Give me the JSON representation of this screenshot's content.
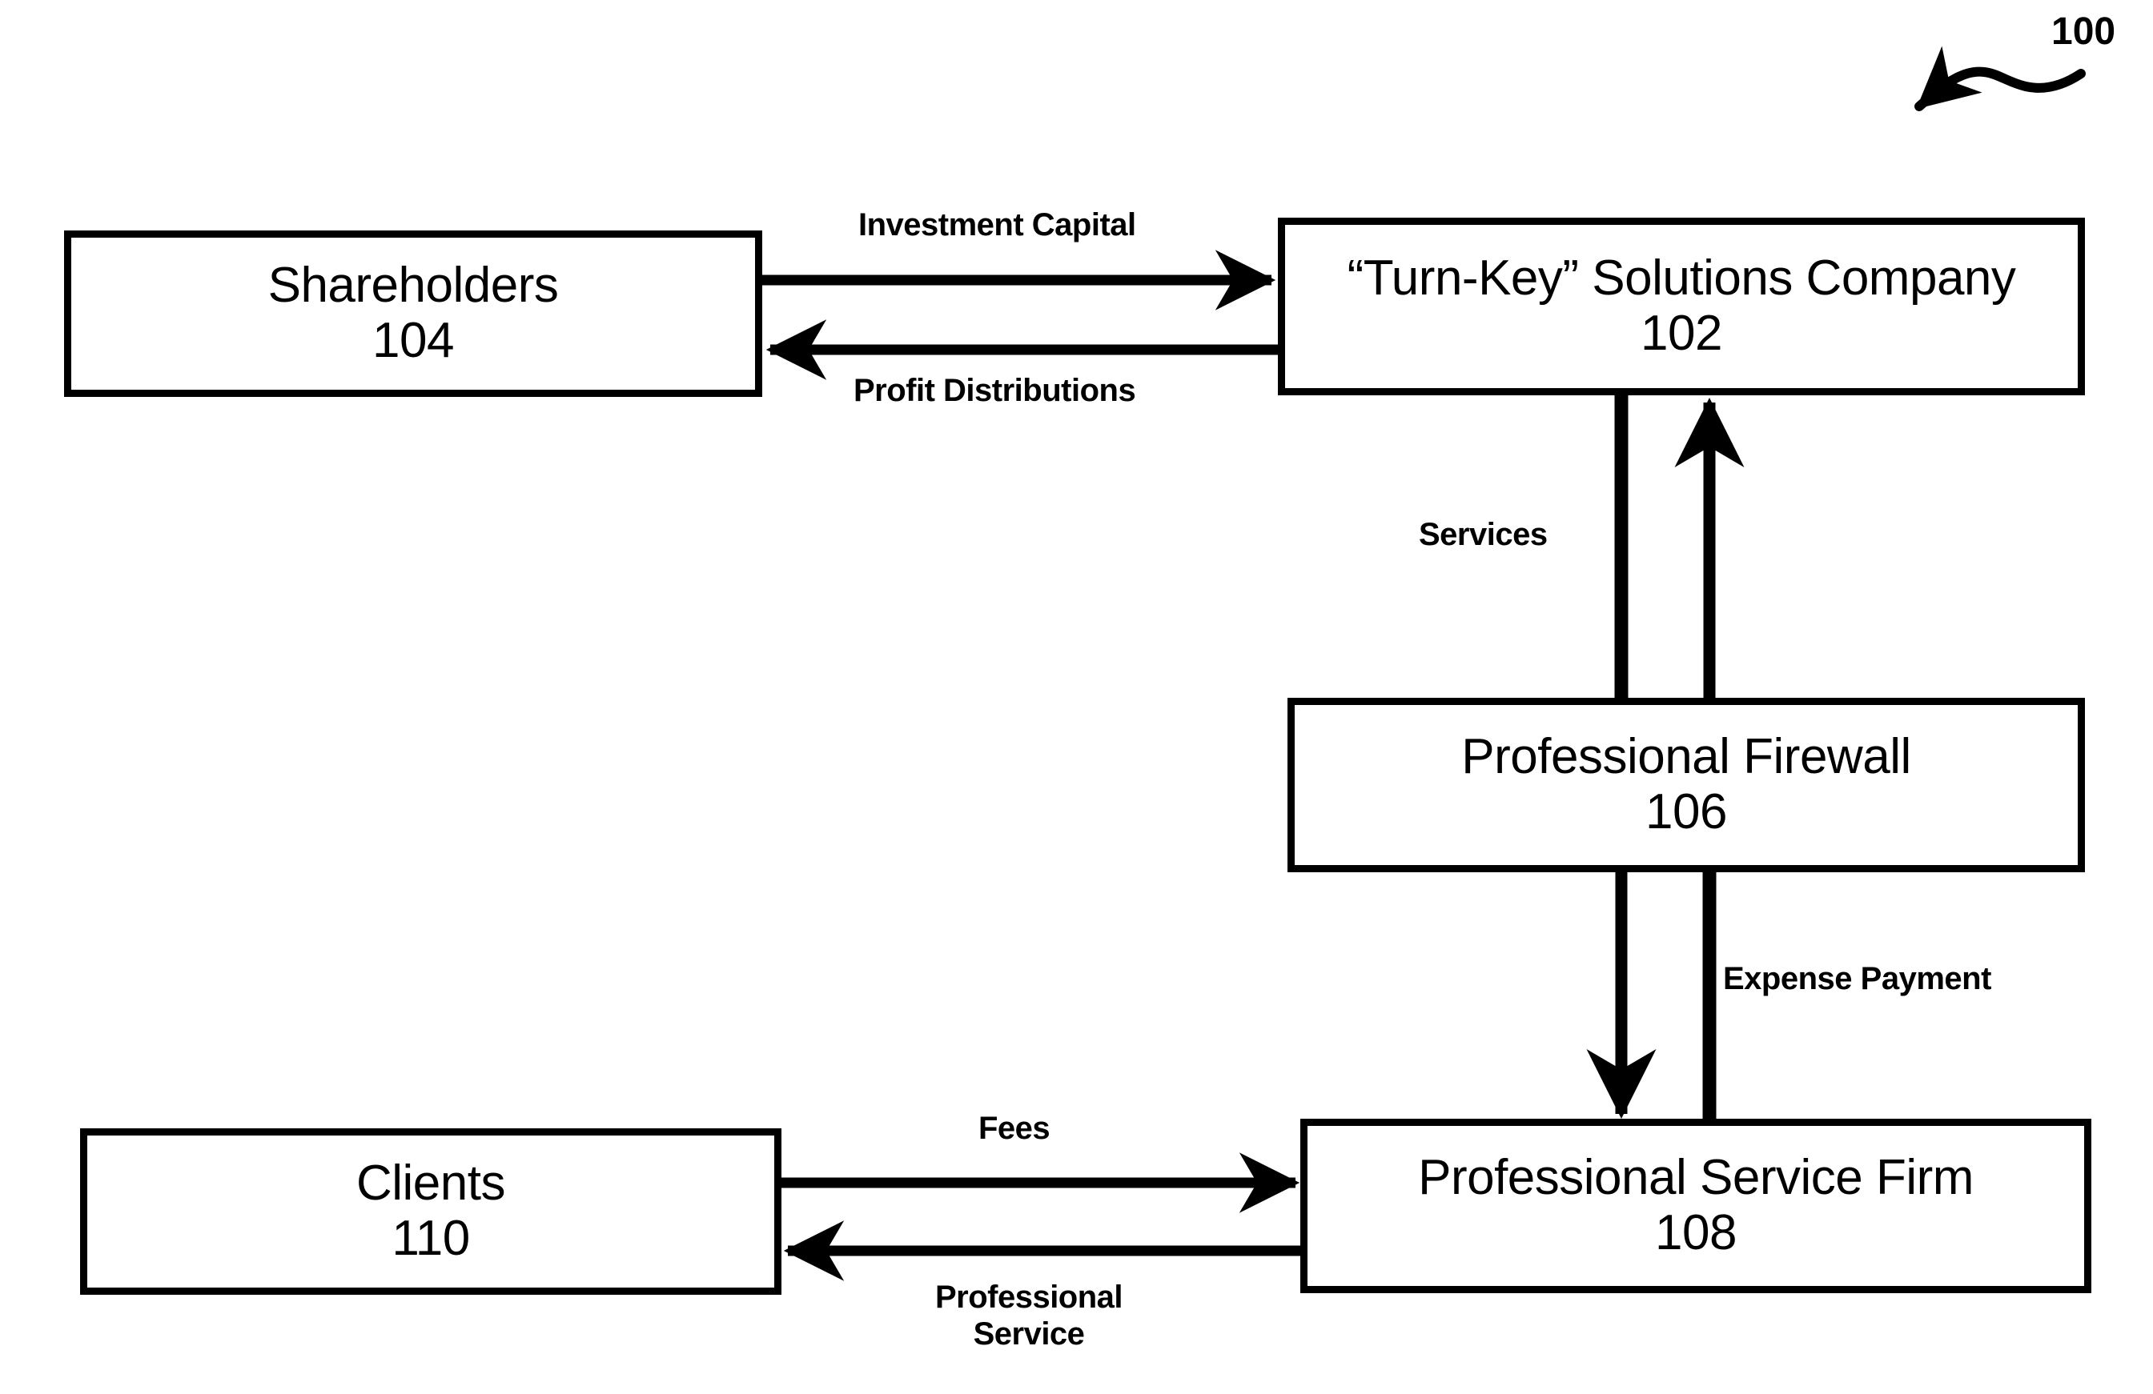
{
  "figure": {
    "number": "100",
    "callout_icon": "curved-arrow-icon"
  },
  "nodes": [
    {
      "id": "turnkey",
      "title": "“Turn-Key” Solutions Company",
      "ref": "102"
    },
    {
      "id": "shareholders",
      "title": "Shareholders",
      "ref": "104"
    },
    {
      "id": "firewall",
      "title": "Professional Firewall",
      "ref": "106"
    },
    {
      "id": "psf",
      "title": "Professional Service Firm",
      "ref": "108"
    },
    {
      "id": "clients",
      "title": "Clients",
      "ref": "110"
    }
  ],
  "edges": [
    {
      "id": "investment-capital",
      "label": "Investment Capital",
      "from": "shareholders",
      "to": "turnkey",
      "direction": "right"
    },
    {
      "id": "profit-distributions",
      "label": "Profit Distributions",
      "from": "turnkey",
      "to": "shareholders",
      "direction": "left"
    },
    {
      "id": "services",
      "label": "Services",
      "from": "firewall",
      "to": "turnkey",
      "direction": "up"
    },
    {
      "id": "expense-payment",
      "label": "Expense Payment",
      "from": "psf",
      "to": "firewall",
      "direction": "up"
    },
    {
      "id": "fees",
      "label": "Fees",
      "from": "clients",
      "to": "psf",
      "direction": "right"
    },
    {
      "id": "professional-service",
      "label_line1": "Professional",
      "label_line2": "Service",
      "from": "psf",
      "to": "clients",
      "direction": "left"
    }
  ],
  "style": {
    "stroke": "#000000",
    "background": "#ffffff"
  }
}
